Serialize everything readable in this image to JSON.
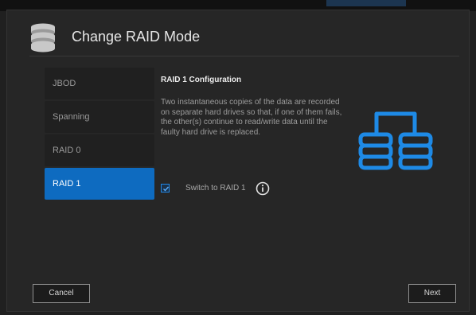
{
  "dialog": {
    "title": "Change RAID Mode",
    "header_icon": "storage-stack-icon"
  },
  "modes": [
    {
      "label": "JBOD",
      "selected": false
    },
    {
      "label": "Spanning",
      "selected": false
    },
    {
      "label": "RAID 0",
      "selected": false
    },
    {
      "label": "RAID 1",
      "selected": true
    }
  ],
  "config": {
    "title": "RAID 1 Configuration",
    "description": "Two instantaneous copies of the data are recorded on separate hard drives so that, if one of them fails, the other(s) continue to read/write data until the faulty hard drive is replaced.",
    "illustration": "mirrored-drives-icon"
  },
  "switch": {
    "label": "Switch to RAID 1",
    "checked": true,
    "info_icon": "info-icon"
  },
  "footer": {
    "cancel_label": "Cancel",
    "next_label": "Next"
  },
  "colors": {
    "accent": "#0e6bc0",
    "background": "#262626",
    "tab_background": "#202020"
  }
}
